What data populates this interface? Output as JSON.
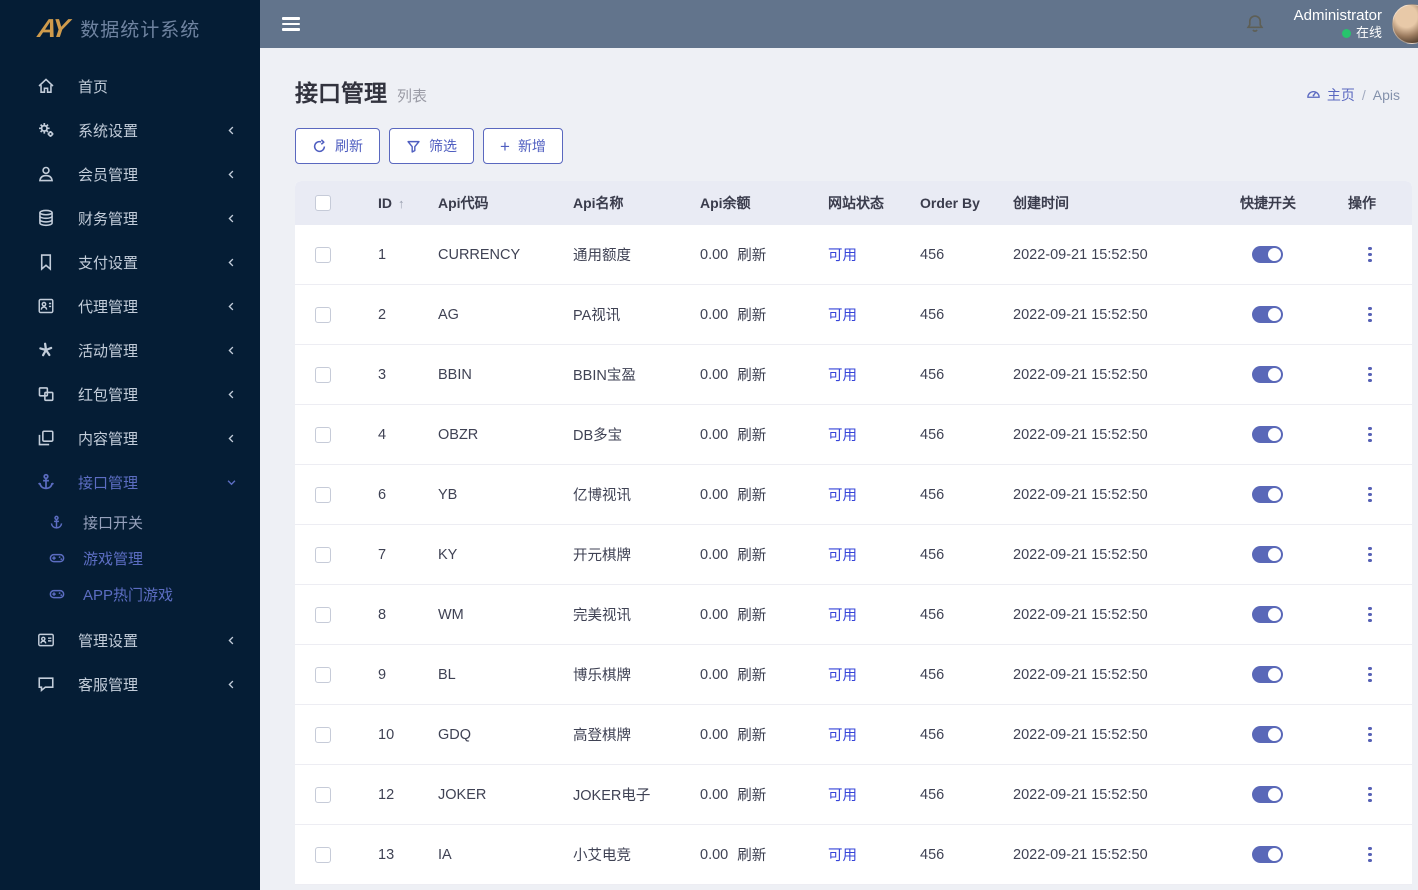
{
  "app": {
    "logo_text": "AY",
    "title": "数据统计系统"
  },
  "topbar": {
    "username": "Administrator",
    "status": "在线"
  },
  "sidebar": {
    "items": [
      {
        "label": "首页"
      },
      {
        "label": "系统设置"
      },
      {
        "label": "会员管理"
      },
      {
        "label": "财务管理"
      },
      {
        "label": "支付设置"
      },
      {
        "label": "代理管理"
      },
      {
        "label": "活动管理"
      },
      {
        "label": "红包管理"
      },
      {
        "label": "内容管理"
      },
      {
        "label": "接口管理",
        "children": [
          {
            "label": "接口开关"
          },
          {
            "label": "游戏管理"
          },
          {
            "label": "APP热门游戏"
          }
        ]
      },
      {
        "label": "管理设置"
      },
      {
        "label": "客服管理"
      }
    ]
  },
  "page": {
    "title": "接口管理",
    "subtitle": "列表",
    "breadcrumb": {
      "home": "主页",
      "separator": "/",
      "current": "Apis"
    }
  },
  "toolbar": {
    "refresh": "刷新",
    "filter": "筛选",
    "add": "新增"
  },
  "table": {
    "headers": [
      "ID",
      "Api代码",
      "Api名称",
      "Api余额",
      "网站状态",
      "Order By",
      "创建时间",
      "快捷开关",
      "操作"
    ],
    "rows": [
      {
        "id": "1",
        "code": "CURRENCY",
        "name": "通用额度",
        "balance": "0.00",
        "refresh_label": "刷新",
        "status": "可用",
        "order_by": "456",
        "created_at": "2022-09-21 15:52:50",
        "switch_on": true
      },
      {
        "id": "2",
        "code": "AG",
        "name": "PA视讯",
        "balance": "0.00",
        "refresh_label": "刷新",
        "status": "可用",
        "order_by": "456",
        "created_at": "2022-09-21 15:52:50",
        "switch_on": true
      },
      {
        "id": "3",
        "code": "BBIN",
        "name": "BBIN宝盈",
        "balance": "0.00",
        "refresh_label": "刷新",
        "status": "可用",
        "order_by": "456",
        "created_at": "2022-09-21 15:52:50",
        "switch_on": true
      },
      {
        "id": "4",
        "code": "OBZR",
        "name": "DB多宝",
        "balance": "0.00",
        "refresh_label": "刷新",
        "status": "可用",
        "order_by": "456",
        "created_at": "2022-09-21 15:52:50",
        "switch_on": true
      },
      {
        "id": "6",
        "code": "YB",
        "name": "亿博视讯",
        "balance": "0.00",
        "refresh_label": "刷新",
        "status": "可用",
        "order_by": "456",
        "created_at": "2022-09-21 15:52:50",
        "switch_on": true
      },
      {
        "id": "7",
        "code": "KY",
        "name": "开元棋牌",
        "balance": "0.00",
        "refresh_label": "刷新",
        "status": "可用",
        "order_by": "456",
        "created_at": "2022-09-21 15:52:50",
        "switch_on": true
      },
      {
        "id": "8",
        "code": "WM",
        "name": "完美视讯",
        "balance": "0.00",
        "refresh_label": "刷新",
        "status": "可用",
        "order_by": "456",
        "created_at": "2022-09-21 15:52:50",
        "switch_on": true
      },
      {
        "id": "9",
        "code": "BL",
        "name": "博乐棋牌",
        "balance": "0.00",
        "refresh_label": "刷新",
        "status": "可用",
        "order_by": "456",
        "created_at": "2022-09-21 15:52:50",
        "switch_on": true
      },
      {
        "id": "10",
        "code": "GDQ",
        "name": "高登棋牌",
        "balance": "0.00",
        "refresh_label": "刷新",
        "status": "可用",
        "order_by": "456",
        "created_at": "2022-09-21 15:52:50",
        "switch_on": true
      },
      {
        "id": "12",
        "code": "JOKER",
        "name": "JOKER电子",
        "balance": "0.00",
        "refresh_label": "刷新",
        "status": "可用",
        "order_by": "456",
        "created_at": "2022-09-21 15:52:50",
        "switch_on": true
      },
      {
        "id": "13",
        "code": "IA",
        "name": "小艾电竞",
        "balance": "0.00",
        "refresh_label": "刷新",
        "status": "可用",
        "order_by": "456",
        "created_at": "2022-09-21 15:52:50",
        "switch_on": true
      }
    ]
  },
  "colors": {
    "sidebar_bg": "#051d35",
    "topbar_bg": "#62748c",
    "accent_purple": "#5a68bf",
    "status_link_blue": "#3644d8",
    "logo_gold": "#cf9b4c",
    "online_green": "#27c46d",
    "page_bg": "#eef0f5",
    "table_header_bg": "#e9ebf4"
  }
}
